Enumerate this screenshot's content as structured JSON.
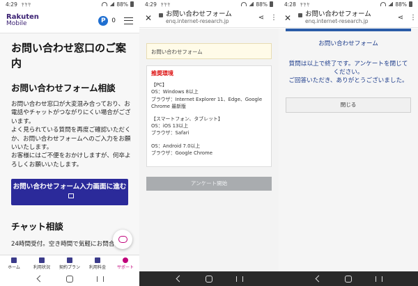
{
  "colors": {
    "rakuten_purple": "#3b2173",
    "cta_blue": "#2b2a9a",
    "support_magenta": "#c0007a",
    "survey_link": "#1a3a8a",
    "required_red": "#d11111"
  },
  "panel1": {
    "status": {
      "time": "4:29",
      "signal": "ﾔﾔﾔ",
      "battery": "88%"
    },
    "header": {
      "logo_line1": "Rakuten",
      "logo_line2": "Mobile",
      "point_icon": "P",
      "point_count": "0",
      "menu_icon": "hamburger-icon"
    },
    "title": "お問い合わせ窓口のご案内",
    "form_heading": "お問い合わせフォーム相談",
    "form_text": "お問い合わせ窓口が大変混み合っており、お電話やチャットがつながりにくい場合がございます。\nよく見られている質問を再度ご確認いただくか、お問い合わせフォームへのご入力をお願いいたします。\nお客様にはご不便をおかけしますが、何卒よろしくお願いいたします。",
    "cta_button": "お問い合わせフォーム入力画面に進む",
    "chat_heading": "チャット相談",
    "chat_text": "24時間受付。空き時間で気軽にお問合せ",
    "tabs": [
      {
        "label": "ホーム",
        "icon": "home-icon"
      },
      {
        "label": "利用状況",
        "icon": "usage-icon"
      },
      {
        "label": "契約プラン",
        "icon": "contract-icon"
      },
      {
        "label": "利用料金",
        "icon": "billing-icon"
      },
      {
        "label": "サポート",
        "icon": "support-icon",
        "active": true
      }
    ]
  },
  "panel2": {
    "status": {
      "time": "4:29",
      "signal": "ﾔﾔﾔ",
      "battery": "88%"
    },
    "browser": {
      "title": "お問い合わせフォーム",
      "url": "enq.internet-research.jp"
    },
    "notice": "お問い合わせフォーム",
    "required_label": "推奨環境",
    "pc_heading": "【PC】",
    "pc_os": "OS：Windows 8以上",
    "pc_browser": "ブラウザ：Internet Explorer 11、Edge、Google Chrome 最新版",
    "sp_heading": "【スマートフォン、タブレット】",
    "ios_os": "OS：iOS 13以上",
    "ios_browser": "ブラウザ：Safari",
    "android_os": "OS：Android 7.0以上",
    "android_browser": "ブラウザ：Google Chrome",
    "start_button": "アンケート開始"
  },
  "panel3": {
    "status": {
      "time": "4:28",
      "signal": "ﾔﾔﾔ",
      "battery": "88%"
    },
    "browser": {
      "title": "お問い合わせフォーム",
      "url": "enq.internet-research.jp"
    },
    "heading": "お問い合わせフォーム",
    "message_line1": "質問は以上で終了です。アンケートを閉じてください。",
    "message_line2": "ご回答いただき、ありがとうございました。",
    "close_button": "閉じる"
  }
}
